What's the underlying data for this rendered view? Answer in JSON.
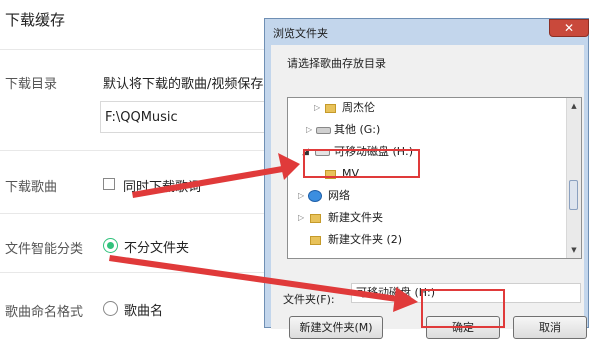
{
  "settings": {
    "section_title": "下载缓存",
    "download_dir_label": "下载目录",
    "download_dir_desc": "默认将下载的歌曲/视频保存",
    "download_dir_value": "F:\\QQMusic",
    "download_songs_label": "下载歌曲",
    "download_lyrics_checkbox": "同时下载歌词",
    "smart_classify_label": "文件智能分类",
    "no_subfolder_option": "不分文件夹",
    "naming_format_label": "歌曲命名格式",
    "song_name_option": "歌曲名"
  },
  "dialog": {
    "title": "浏览文件夹",
    "close_symbol": "✕",
    "prompt": "请选择歌曲存放目录",
    "tree": [
      {
        "label": "周杰伦",
        "icon": "folder-icon",
        "expand": "collapsed"
      },
      {
        "label": "其他 (G:)",
        "icon": "drive-icon",
        "expand": "collapsed"
      },
      {
        "label": "可移动磁盘 (H:)",
        "icon": "removable-drive-icon",
        "expand": "expanded"
      },
      {
        "label": "MV",
        "icon": "folder-icon",
        "expand": "none"
      },
      {
        "label": "网络",
        "icon": "network-icon",
        "expand": "collapsed"
      },
      {
        "label": "新建文件夹",
        "icon": "folder-icon",
        "expand": "collapsed"
      },
      {
        "label": "新建文件夹 (2)",
        "icon": "folder-icon",
        "expand": "none"
      }
    ],
    "folder_field_label": "文件夹(F):",
    "folder_field_value": "可移动磁盘 (H:)",
    "new_folder_button": "新建文件夹(M)",
    "ok_button": "确定",
    "cancel_button": "取消"
  },
  "colors": {
    "accent_green": "#31c27c",
    "annotation_red": "#e03a3a",
    "dialog_frame": "#c3d6ec"
  }
}
